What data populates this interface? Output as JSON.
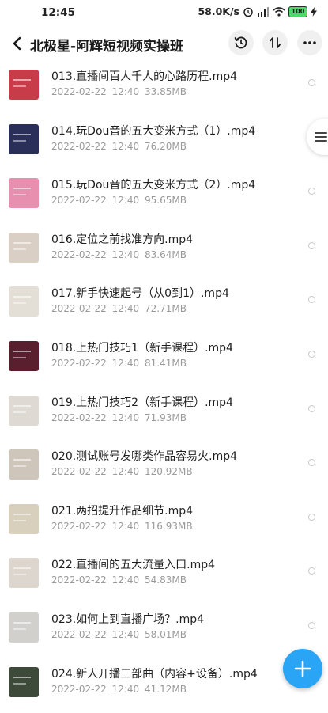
{
  "status_bar": {
    "time": "12:45",
    "network_speed": "58.0K/s",
    "battery_level": "100"
  },
  "header": {
    "title": "北极星-阿辉短视频实操班"
  },
  "files": [
    {
      "name": "013.直播间百人千人的心路历程.mp4",
      "date": "2022-02-22",
      "time": "12:40",
      "size": "33.85MB",
      "thumb_color": "#c83c4a"
    },
    {
      "name": "014.玩Dou音的五大变米方式（1）.mp4",
      "date": "2022-02-22",
      "time": "12:40",
      "size": "76.20MB",
      "thumb_color": "#2a2f5a"
    },
    {
      "name": "015.玩Dou音的五大变米方式（2）.mp4",
      "date": "2022-02-22",
      "time": "12:40",
      "size": "95.65MB",
      "thumb_color": "#e88fb0"
    },
    {
      "name": "016.定位之前找准方向.mp4",
      "date": "2022-02-22",
      "time": "12:40",
      "size": "83.64MB",
      "thumb_color": "#d9cfc4"
    },
    {
      "name": "017.新手快速起号（从0到1）.mp4",
      "date": "2022-02-22",
      "time": "12:40",
      "size": "72.71MB",
      "thumb_color": "#e3ded6"
    },
    {
      "name": "018.上热门技巧1（新手课程）.mp4",
      "date": "2022-02-22",
      "time": "12:40",
      "size": "81.41MB",
      "thumb_color": "#5a1f2e"
    },
    {
      "name": "019.上热门技巧2（新手课程）.mp4",
      "date": "2022-02-22",
      "time": "12:40",
      "size": "71.93MB",
      "thumb_color": "#dedad3"
    },
    {
      "name": "020.测试账号发哪类作品容易火.mp4",
      "date": "2022-02-22",
      "time": "12:40",
      "size": "120.92MB",
      "thumb_color": "#cfc6bb"
    },
    {
      "name": "021.两招提升作品细节.mp4",
      "date": "2022-02-22",
      "time": "12:40",
      "size": "116.93MB",
      "thumb_color": "#d8cfbd"
    },
    {
      "name": "022.直播间的五大流量入口.mp4",
      "date": "2022-02-22",
      "time": "12:40",
      "size": "54.83MB",
      "thumb_color": "#dcd6cf"
    },
    {
      "name": "023.如何上到直播广场？.mp4",
      "date": "2022-02-22",
      "time": "12:40",
      "size": "58.01MB",
      "thumb_color": "#d2d0cd"
    },
    {
      "name": "024.新人开播三部曲（内容+设备）.mp4",
      "date": "2022-02-22",
      "time": "12:40",
      "size": "41.12MB",
      "thumb_color": "#3d4a3a"
    }
  ],
  "icons": {
    "back": "chevron-left-icon",
    "history": "history-clock-icon",
    "sort": "sort-arrows-icon",
    "more": "more-dots-icon",
    "side_menu": "menu-lines-icon",
    "fab": "plus-icon"
  },
  "colors": {
    "accent": "#2aa4f4",
    "meta_text": "#9a9a9a"
  }
}
